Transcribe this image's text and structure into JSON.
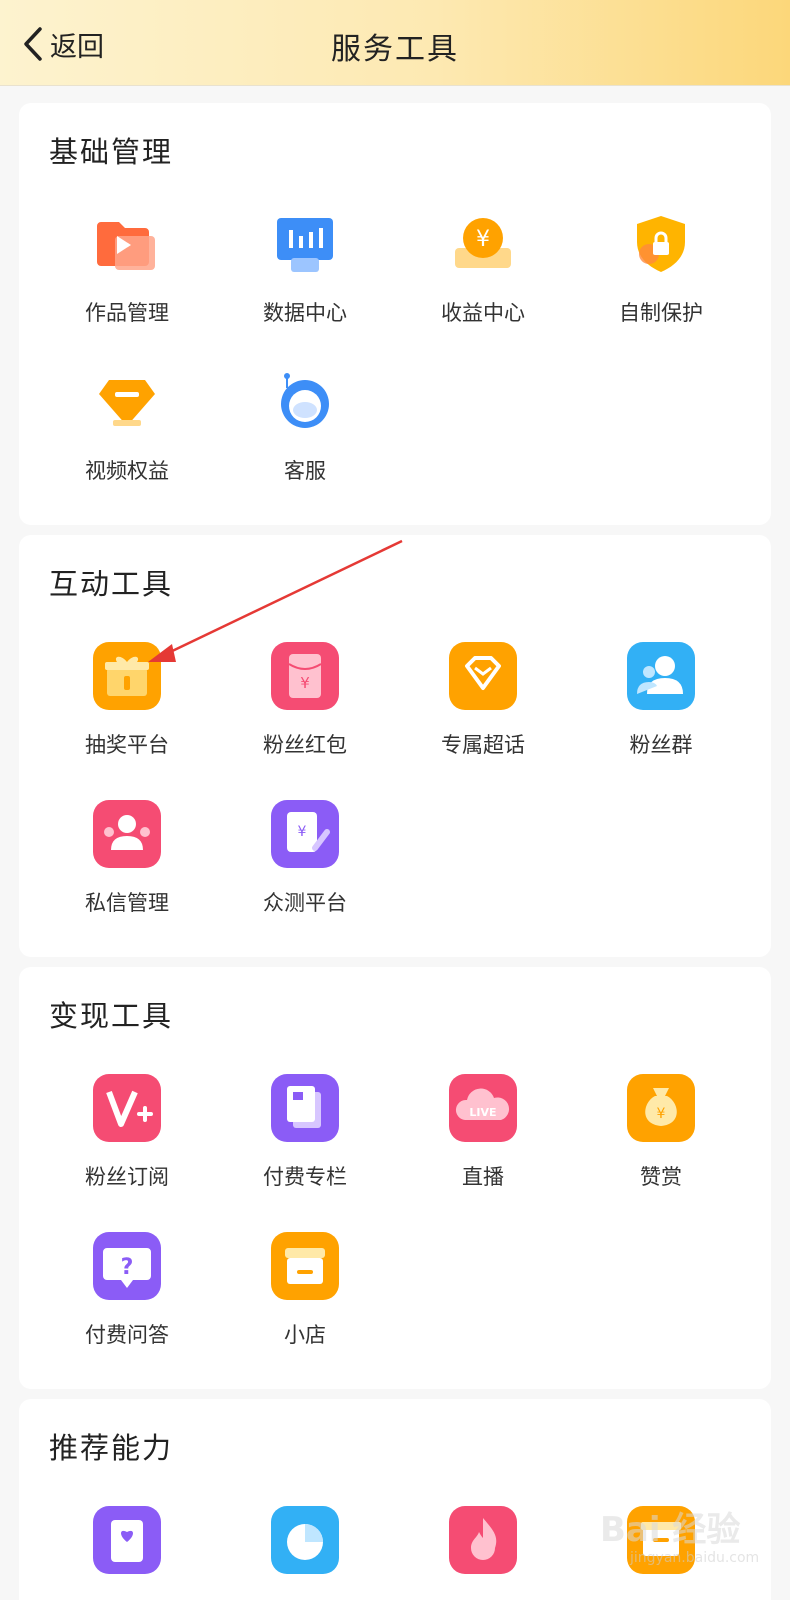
{
  "header": {
    "back_label": "返回",
    "title": "服务工具"
  },
  "sections": [
    {
      "title": "基础管理",
      "items": [
        {
          "label": "作品管理",
          "icon": "video-folder-icon"
        },
        {
          "label": "数据中心",
          "icon": "data-chart-icon"
        },
        {
          "label": "收益中心",
          "icon": "yuan-coin-icon"
        },
        {
          "label": "自制保护",
          "icon": "shield-lock-icon"
        },
        {
          "label": "视频权益",
          "icon": "diamond-icon"
        },
        {
          "label": "客服",
          "icon": "headset-icon"
        }
      ]
    },
    {
      "title": "互动工具",
      "items": [
        {
          "label": "抽奖平台",
          "icon": "gift-box-icon"
        },
        {
          "label": "粉丝红包",
          "icon": "red-packet-icon"
        },
        {
          "label": "专属超话",
          "icon": "gem-icon"
        },
        {
          "label": "粉丝群",
          "icon": "user-group-icon"
        },
        {
          "label": "私信管理",
          "icon": "message-user-icon"
        },
        {
          "label": "众测平台",
          "icon": "review-edit-icon"
        }
      ]
    },
    {
      "title": "变现工具",
      "items": [
        {
          "label": "粉丝订阅",
          "icon": "v-plus-icon"
        },
        {
          "label": "付费专栏",
          "icon": "paid-column-icon"
        },
        {
          "label": "直播",
          "icon": "live-cloud-icon"
        },
        {
          "label": "赞赏",
          "icon": "money-bag-icon"
        },
        {
          "label": "付费问答",
          "icon": "question-bubble-icon"
        },
        {
          "label": "小店",
          "icon": "shop-icon"
        }
      ]
    },
    {
      "title": "推荐能力",
      "items": [
        {
          "label": "",
          "icon": "heart-card-icon"
        },
        {
          "label": "",
          "icon": "pie-chart-icon"
        },
        {
          "label": "",
          "icon": "flame-icon"
        },
        {
          "label": "",
          "icon": "box-icon"
        }
      ]
    }
  ],
  "watermark": {
    "main": "Bai 经验",
    "sub": "jingyan.baidu.com"
  },
  "colors": {
    "header_start": "#fdf3cf",
    "header_end": "#fcd77a",
    "page_bg": "#f7f7f7",
    "card_bg": "#ffffff",
    "annotation_arrow": "#e53935"
  }
}
